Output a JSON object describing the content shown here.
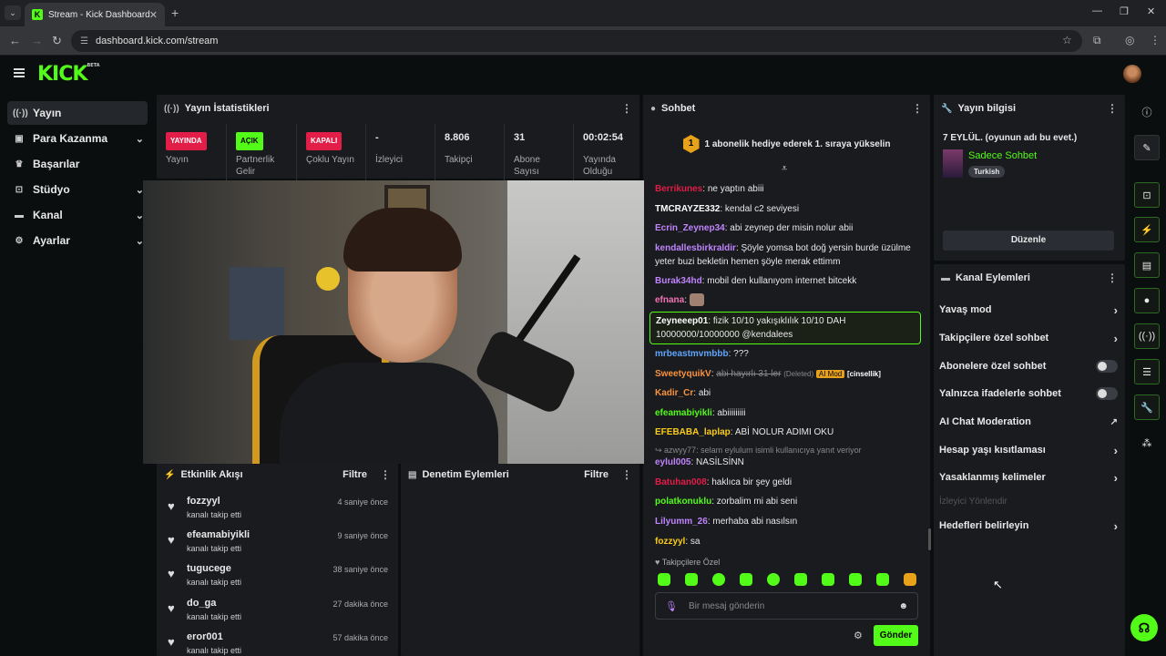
{
  "browser": {
    "tab_title": "Stream - Kick Dashboard",
    "url": "dashboard.kick.com/stream"
  },
  "brand": {
    "logo": "KICK",
    "logo_sup": "BETA",
    "accent": "#53fc18"
  },
  "sidebar": {
    "items": [
      {
        "label": "Yayın",
        "icon": "broadcast-icon"
      },
      {
        "label": "Para Kazanma",
        "icon": "money-icon"
      },
      {
        "label": "Başarılar",
        "icon": "trophy-icon"
      },
      {
        "label": "Stüdyo",
        "icon": "studio-icon"
      },
      {
        "label": "Kanal",
        "icon": "channel-icon"
      },
      {
        "label": "Ayarlar",
        "icon": "gear-icon"
      }
    ]
  },
  "stats": {
    "title": "Yayın İstatistikleri",
    "cols": [
      {
        "value": "YAYINDA",
        "label": "Yayın",
        "color": "#e11d48"
      },
      {
        "value": "AÇIK",
        "label": "Partnerlik Gelir",
        "color": "#53fc18"
      },
      {
        "value": "KAPALI",
        "label": "Çoklu Yayın",
        "color": "#e11d48"
      },
      {
        "value": "-",
        "label": "İzleyici"
      },
      {
        "value": "8.806",
        "label": "Takipçi"
      },
      {
        "value": "31",
        "label": "Abone Sayısı"
      },
      {
        "value": "00:02:54",
        "label": "Yayında Olduğu"
      }
    ]
  },
  "activity": {
    "title": "Etkinlik Akışı",
    "filter": "Filtre",
    "items": [
      {
        "name": "fozzyyl",
        "action": "kanalı takip etti",
        "time": "4 saniye önce"
      },
      {
        "name": "efeamabiyikli",
        "action": "kanalı takip etti",
        "time": "9 saniye önce"
      },
      {
        "name": "tugucege",
        "action": "kanalı takip etti",
        "time": "38 saniye önce"
      },
      {
        "name": "do_ga",
        "action": "kanalı takip etti",
        "time": "27 dakika önce"
      },
      {
        "name": "eror001",
        "action": "kanalı takip etti",
        "time": "57 dakika önce"
      }
    ]
  },
  "moderation": {
    "title": "Denetim Eylemleri",
    "filter": "Filtre"
  },
  "chat": {
    "title": "Sohbet",
    "pinned_rank": "1",
    "pinned": "1 abonelik hediye ederek 1. sıraya yükselin",
    "messages": [
      {
        "user": "Berrikunes",
        "color": "#e11d48",
        "text": "ne yaptın abiii"
      },
      {
        "user": "TMCRAYZE332",
        "color": "#ffffff",
        "text": "kendal c2 seviyesi"
      },
      {
        "user": "Ecrin_Zeynep34",
        "color": "#c084fc",
        "text": "abi zeynep der misin nolur abii"
      },
      {
        "user": "kendallesbirkraldir",
        "color": "#c084fc",
        "text": "Şöyle yomsa bot doğ yersin burde üzülme yeter buzi bekletin hemen şöyle merak ettimm"
      },
      {
        "user": "Burak34hd",
        "color": "#c084fc",
        "text": "mobil den kullanıyom internet bitcekk"
      },
      {
        "user": "efnana",
        "color": "#f472b6",
        "text": ""
      },
      {
        "user": "Zeyneeep01",
        "color": "#ffffff",
        "text": "fizik 10/10 yakışıklılık 10/10 DAH 10000000/10000000 @kendalees"
      },
      {
        "user": "mrbeastmvmbbb",
        "color": "#60a5fa",
        "text": "???"
      },
      {
        "user": "SweetyquikV",
        "color": "#fb923c",
        "deleted": "abi hayırlı 31 ler",
        "deleted_tag": "(Deleted)",
        "ai_tag": "AI Mod",
        "reason": "[cinsellik]"
      },
      {
        "user": "Kadir_Cr",
        "color": "#fb923c",
        "text": "abi"
      },
      {
        "user": "efeamabiyikli",
        "color": "#53fc18",
        "text": "abiiiiiiiii"
      },
      {
        "user": "EFEBABA_laplap",
        "color": "#facc15",
        "text": "ABİ NOLUR ADIMI OKU"
      },
      {
        "user": "eylul005",
        "color": "#c084fc",
        "text": "NASİLSİNN",
        "reply": "azwyy77: selam eylulum isimli kullanıcıya yanıt veriyor"
      },
      {
        "user": "Batuhan008",
        "color": "#e11d48",
        "text": "haklıca bir şey geldi"
      },
      {
        "user": "polatkonuklu",
        "color": "#53fc18",
        "text": "zorbalim mi abi seni"
      },
      {
        "user": "Lilyumm_26",
        "color": "#c084fc",
        "text": "merhaba abi nasılsın"
      },
      {
        "user": "fozzyyl",
        "color": "#facc15",
        "text": "sa"
      }
    ],
    "followers_only": "Takipçilere Özel",
    "input_placeholder": "Bir mesaj gönderin",
    "send": "Gönder"
  },
  "stream_info": {
    "title": "Yayın bilgisi",
    "stream_title": "7 EYLÜL. (oyunun adı bu evet.)",
    "category": "Sadece Sohbet",
    "language": "Turkish",
    "edit": "Düzenle"
  },
  "channel_actions": {
    "title": "Kanal Eylemleri",
    "items": [
      {
        "label": "Yavaş mod",
        "type": "arrow"
      },
      {
        "label": "Takipçilere özel sohbet",
        "type": "arrow"
      },
      {
        "label": "Abonelere özel sohbet",
        "type": "toggle"
      },
      {
        "label": "Yalnızca ifadelerle sohbet",
        "type": "toggle"
      },
      {
        "label": "AI Chat Moderation",
        "type": "external"
      },
      {
        "label": "Hesap yaşı kısıtlaması",
        "type": "arrow"
      },
      {
        "label": "Yasaklanmış kelimeler",
        "type": "arrow"
      },
      {
        "label": "İzleyici Yönlendir",
        "type": "disabled"
      },
      {
        "label": "Hedefleri belirleyin",
        "type": "arrow"
      }
    ]
  }
}
